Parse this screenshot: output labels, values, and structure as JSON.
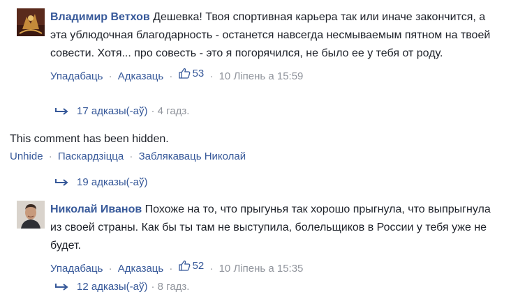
{
  "comments": [
    {
      "author": "Владимир Ветхов",
      "text": " Дешевка! Твоя спортивная карьера так или иначе закончится, а эта ублюдочная благодарность - останется навсегда несмываемым пятном на твоей совести. Хотя... про совесть - это я погорячился, не было ее у тебя от роду.",
      "like_label": "Упадабаць",
      "reply_label": "Адказаць",
      "likes": "53",
      "timestamp": "10 Ліпень а 15:59",
      "replies_label": "17 адказы(-аў)",
      "replies_ago": "· 4 гадз.",
      "avatar_icon": "user-avatar-photo"
    },
    {
      "author": "Николай Иванов",
      "text": " Похоже на то, что прыгунья так хорошо прыгнула, что выпрыгнула из своей страны. Как бы ты там не выступила, болельщиков в России у тебя уже не будет.",
      "like_label": "Упадабаць",
      "reply_label": "Адказаць",
      "likes": "52",
      "timestamp": "10 Ліпень а 15:35",
      "replies_label": "12 адказы(-аў)",
      "replies_ago": "· 8 гадз.",
      "avatar_icon": "user-avatar-photo"
    }
  ],
  "hidden_comment": {
    "notice": "This comment has been hidden.",
    "unhide_label": "Unhide",
    "report_label": "Паскардзіцца",
    "block_label": "Заблякаваць Николай",
    "replies_label": "19 адказы(-аў)"
  },
  "separator": "·",
  "colors": {
    "link": "#365899",
    "meta": "#90949c",
    "text": "#1d2129"
  },
  "icons": {
    "like": "thumbs-up-icon",
    "reply_arrow": "reply-arrow-icon"
  }
}
